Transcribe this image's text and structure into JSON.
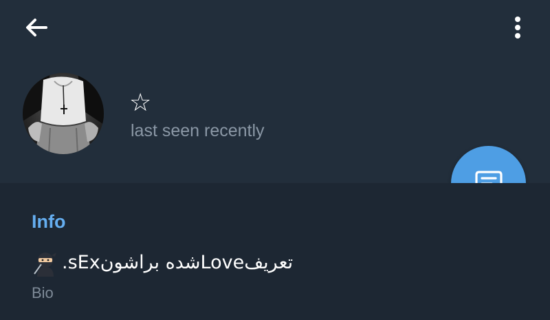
{
  "header": {
    "back_icon": "arrow-left-icon",
    "menu_icon": "more-vertical-icon"
  },
  "profile": {
    "name": "☆",
    "status": "last seen recently"
  },
  "fab": {
    "icon": "message-icon",
    "color": "#4e9ee4"
  },
  "info": {
    "title": "Info",
    "bio_emoji": "ninja-emoji",
    "bio": ".sExشده براشونLoveتعریف",
    "bio_label": "Bio"
  },
  "colors": {
    "background": "#1d2733",
    "header_background": "#222e3b",
    "accent": "#65aef0",
    "secondary_text": "#8b98a6"
  }
}
